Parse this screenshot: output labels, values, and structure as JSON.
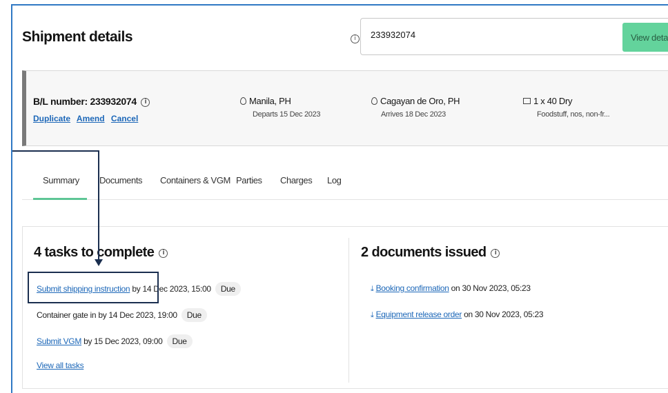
{
  "header": {
    "title": "Shipment details",
    "search_value": "233932074",
    "view_button": "View details"
  },
  "shipment": {
    "bl_label": "B/L number: 233932074",
    "actions": [
      "Duplicate",
      "Amend",
      "Cancel"
    ],
    "origin": "Manila, PH",
    "origin_sub": "Departs 15 Dec 2023",
    "destination": "Cagayan de Oro, PH",
    "destination_sub": "Arrives 18 Dec 2023",
    "container": "1 x 40 Dry",
    "container_sub": "Foodstuff, nos, non-fr..."
  },
  "tabs": [
    "Summary",
    "Documents",
    "Containers & VGM",
    "Parties",
    "Charges",
    "Log"
  ],
  "tasks": {
    "title": "4 tasks to complete",
    "items": [
      {
        "link": "Submit shipping instruction",
        "text": " by 14 Dec 2023, 15:00",
        "badge": "Due"
      },
      {
        "link": "",
        "text": "Container gate in by 14 Dec 2023, 19:00",
        "badge": "Due"
      },
      {
        "link": "Submit VGM",
        "text": " by 15 Dec 2023, 09:00",
        "badge": "Due"
      }
    ],
    "view_all": "View all tasks"
  },
  "documents": {
    "title": "2 documents issued",
    "items": [
      {
        "link": "Booking confirmation",
        "text": " on 30 Nov 2023, 05:23"
      },
      {
        "link": "Equipment release order",
        "text": " on 30 Nov 2023, 05:23"
      }
    ]
  },
  "colors": {
    "accent_green": "#63d39c",
    "link_blue": "#1c67b8",
    "annotation": "#1a2e4f"
  }
}
